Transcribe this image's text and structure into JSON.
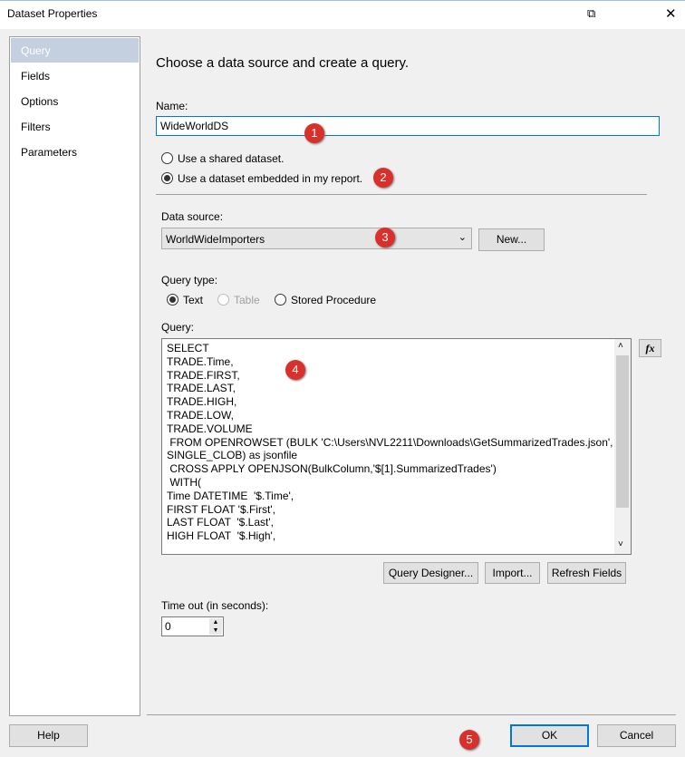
{
  "window": {
    "title": "Dataset Properties",
    "close": "✕",
    "restore": "⧉"
  },
  "sidebar": {
    "items": [
      {
        "label": "Query"
      },
      {
        "label": "Fields"
      },
      {
        "label": "Options"
      },
      {
        "label": "Filters"
      },
      {
        "label": "Parameters"
      }
    ]
  },
  "main": {
    "heading": "Choose a data source and create a query.",
    "name_label": "Name:",
    "name_value": "WideWorldDS",
    "radio_shared": "Use a shared dataset.",
    "radio_embedded": "Use a dataset embedded in my report.",
    "datasource_label": "Data source:",
    "datasource_value": "WorldWideImporters",
    "new_button": "New...",
    "querytype_label": "Query type:",
    "qt_text": "Text",
    "qt_table": "Table",
    "qt_sp": "Stored Procedure",
    "query_label": "Query:",
    "query_text": "SELECT\nTRADE.Time,\nTRADE.FIRST,\nTRADE.LAST,\nTRADE.HIGH,\nTRADE.LOW,\nTRADE.VOLUME\n FROM OPENROWSET (BULK 'C:\\Users\\NVL2211\\Downloads\\GetSummarizedTrades.json',\nSINGLE_CLOB) as jsonfile\n CROSS APPLY OPENJSON(BulkColumn,'$[1].SummarizedTrades')\n WITH(\nTime DATETIME  '$.Time',\nFIRST FLOAT '$.First',\nLAST FLOAT  '$.Last',\nHIGH FLOAT  '$.High',",
    "fx": "fx",
    "query_designer": "Query Designer...",
    "import": "Import...",
    "refresh": "Refresh Fields",
    "timeout_label": "Time out (in seconds):",
    "timeout_value": "0"
  },
  "footer": {
    "help": "Help",
    "ok": "OK",
    "cancel": "Cancel"
  },
  "badges": [
    "1",
    "2",
    "3",
    "4",
    "5"
  ]
}
